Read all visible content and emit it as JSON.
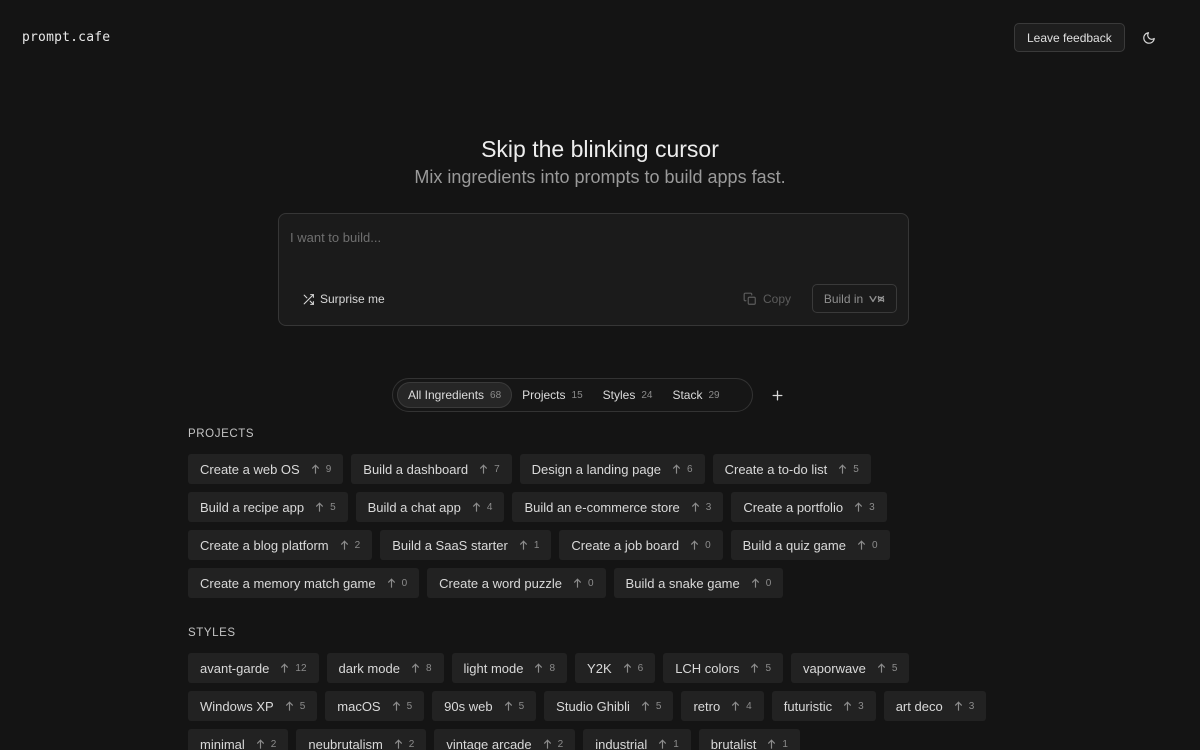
{
  "header": {
    "logo": "prompt.cafe",
    "feedback_label": "Leave feedback",
    "theme_icon": "moon-icon"
  },
  "hero": {
    "title": "Skip the blinking cursor",
    "subtitle": "Mix ingredients into prompts to build apps fast."
  },
  "prompt": {
    "placeholder": "I want to build...",
    "value": "",
    "surprise_label": "Surprise me",
    "copy_label": "Copy",
    "build_label": "Build in"
  },
  "tabs": [
    {
      "label": "All Ingredients",
      "count": "68",
      "active": true
    },
    {
      "label": "Projects",
      "count": "15",
      "active": false
    },
    {
      "label": "Styles",
      "count": "24",
      "active": false
    },
    {
      "label": "Stack",
      "count": "29",
      "active": false
    }
  ],
  "projects": {
    "title": "PROJECTS",
    "items": [
      {
        "label": "Create a web OS",
        "votes": "9"
      },
      {
        "label": "Build a dashboard",
        "votes": "7"
      },
      {
        "label": "Design a landing page",
        "votes": "6"
      },
      {
        "label": "Create a to-do list",
        "votes": "5"
      },
      {
        "label": "Build a recipe app",
        "votes": "5"
      },
      {
        "label": "Build a chat app",
        "votes": "4"
      },
      {
        "label": "Build an e-commerce store",
        "votes": "3"
      },
      {
        "label": "Create a portfolio",
        "votes": "3"
      },
      {
        "label": "Create a blog platform",
        "votes": "2"
      },
      {
        "label": "Build a SaaS starter",
        "votes": "1"
      },
      {
        "label": "Create a job board",
        "votes": "0"
      },
      {
        "label": "Build a quiz game",
        "votes": "0"
      },
      {
        "label": "Create a memory match game",
        "votes": "0"
      },
      {
        "label": "Create a word puzzle",
        "votes": "0"
      },
      {
        "label": "Build a snake game",
        "votes": "0"
      }
    ]
  },
  "styles": {
    "title": "STYLES",
    "items": [
      {
        "label": "avant-garde",
        "votes": "12"
      },
      {
        "label": "dark mode",
        "votes": "8"
      },
      {
        "label": "light mode",
        "votes": "8"
      },
      {
        "label": "Y2K",
        "votes": "6"
      },
      {
        "label": "LCH colors",
        "votes": "5"
      },
      {
        "label": "vaporwave",
        "votes": "5"
      },
      {
        "label": "Windows XP",
        "votes": "5"
      },
      {
        "label": "macOS",
        "votes": "5"
      },
      {
        "label": "90s web",
        "votes": "5"
      },
      {
        "label": "Studio Ghibli",
        "votes": "5"
      },
      {
        "label": "retro",
        "votes": "4"
      },
      {
        "label": "futuristic",
        "votes": "3"
      },
      {
        "label": "art deco",
        "votes": "3"
      },
      {
        "label": "minimal",
        "votes": "2"
      },
      {
        "label": "neubrutalism",
        "votes": "2"
      },
      {
        "label": "vintage arcade",
        "votes": "2"
      },
      {
        "label": "industrial",
        "votes": "1"
      },
      {
        "label": "brutalist",
        "votes": "1"
      }
    ]
  }
}
